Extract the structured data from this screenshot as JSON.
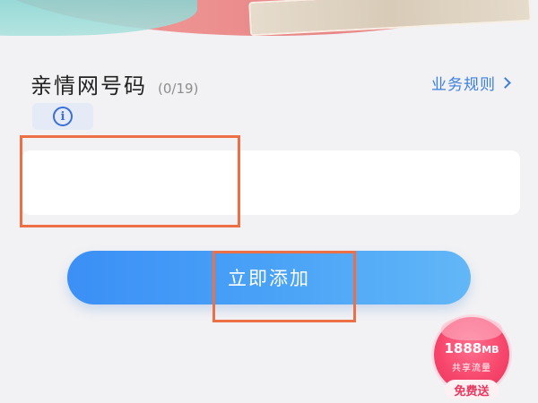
{
  "section": {
    "title": "亲情网号码",
    "count": "(0/19)",
    "rules_link": "业务规则"
  },
  "info": {
    "icon": "info-icon",
    "glyph": "i"
  },
  "number_input": {
    "value": "",
    "placeholder": ""
  },
  "add_button": {
    "label": "立即添加"
  },
  "promo": {
    "amount": "1888",
    "unit": "MB",
    "subtitle": "共享流量",
    "ribbon": "免费送"
  },
  "colors": {
    "accent": "#3b7fe0",
    "button_start": "#3b8ff6",
    "button_end": "#62b7f7",
    "highlight": "#ed6f45",
    "promo": "#f7466b"
  }
}
